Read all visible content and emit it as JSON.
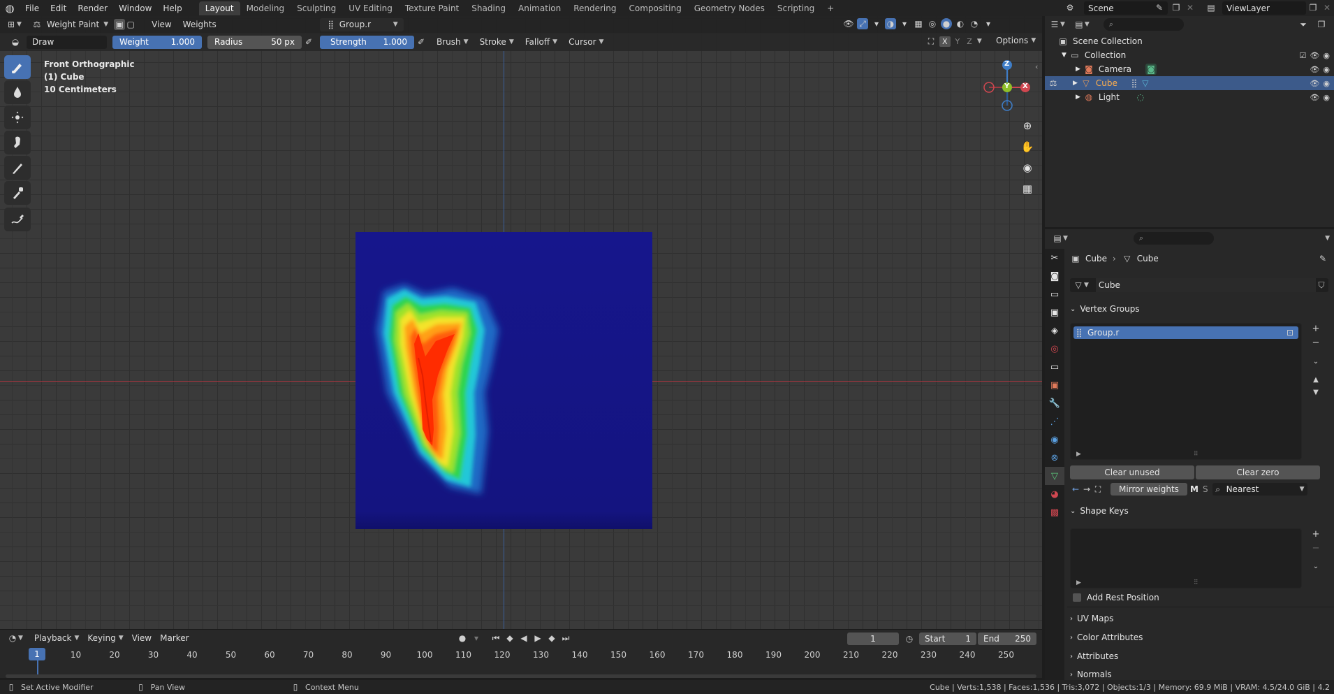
{
  "menu": {
    "items": [
      "File",
      "Edit",
      "Render",
      "Window",
      "Help"
    ],
    "workspaces": [
      "Layout",
      "Modeling",
      "Sculpting",
      "UV Editing",
      "Texture Paint",
      "Shading",
      "Animation",
      "Rendering",
      "Compositing",
      "Geometry Nodes",
      "Scripting"
    ],
    "active_workspace": "Layout",
    "add_tab": "+",
    "scene": "Scene",
    "view_layer": "ViewLayer"
  },
  "viewport": {
    "mode": "Weight Paint",
    "view_menu": "View",
    "weights_menu": "Weights",
    "vertex_group": "Group.r",
    "tool_name": "Draw",
    "weight_label": "Weight",
    "weight_value": "1.000",
    "radius_label": "Radius",
    "radius_value": "50 px",
    "strength_label": "Strength",
    "strength_value": "1.000",
    "brush": "Brush",
    "stroke": "Stroke",
    "falloff": "Falloff",
    "cursor": "Cursor",
    "options": "Options",
    "axis_x": "X",
    "axis_y": "Y",
    "axis_z": "Z",
    "info_line1": "Front Orthographic",
    "info_line2": "(1) Cube",
    "info_line3": "10 Centimeters",
    "gizmo_z": "Z",
    "gizmo_y": "Y",
    "gizmo_x": "X"
  },
  "timeline": {
    "playback": "Playback",
    "keying": "Keying",
    "view": "View",
    "marker": "Marker",
    "current_frame": "1",
    "start_label": "Start",
    "start_value": "1",
    "end_label": "End",
    "end_value": "250",
    "ruler": [
      "10",
      "20",
      "30",
      "40",
      "50",
      "60",
      "70",
      "80",
      "90",
      "100",
      "110",
      "120",
      "130",
      "140",
      "150",
      "160",
      "170",
      "180",
      "190",
      "200",
      "210",
      "220",
      "230",
      "240",
      "250"
    ],
    "cursor_label": "1"
  },
  "status": {
    "left1": "Set Active Modifier",
    "left2": "Pan View",
    "left3": "Context Menu",
    "stats": "Cube | Verts:1,538 | Faces:1,536 | Tris:3,072 | Objects:1/3 | Memory: 69.9 MiB | VRAM: 4.5/24.0 GiB | 4.2"
  },
  "outliner": {
    "scene_collection": "Scene Collection",
    "collection": "Collection",
    "items": [
      "Camera",
      "Cube",
      "Light"
    ]
  },
  "properties": {
    "breadcrumb_object": "Cube",
    "breadcrumb_data": "Cube",
    "mesh_name": "Cube",
    "vertex_groups_title": "Vertex Groups",
    "vertex_group_item": "Group.r",
    "clear_unused": "Clear unused",
    "clear_zero": "Clear zero",
    "mirror_weights": "Mirror weights",
    "mirror_m": "M",
    "mirror_s": "S",
    "nearest": "Nearest",
    "shape_keys_title": "Shape Keys",
    "add_rest_position": "Add Rest Position",
    "collapsed_sections": [
      "UV Maps",
      "Color Attributes",
      "Attributes",
      "Normals"
    ]
  },
  "colors": {
    "accent": "#4772b3",
    "weight_zero": "#15168a",
    "weight_full": "#ff2a00"
  }
}
